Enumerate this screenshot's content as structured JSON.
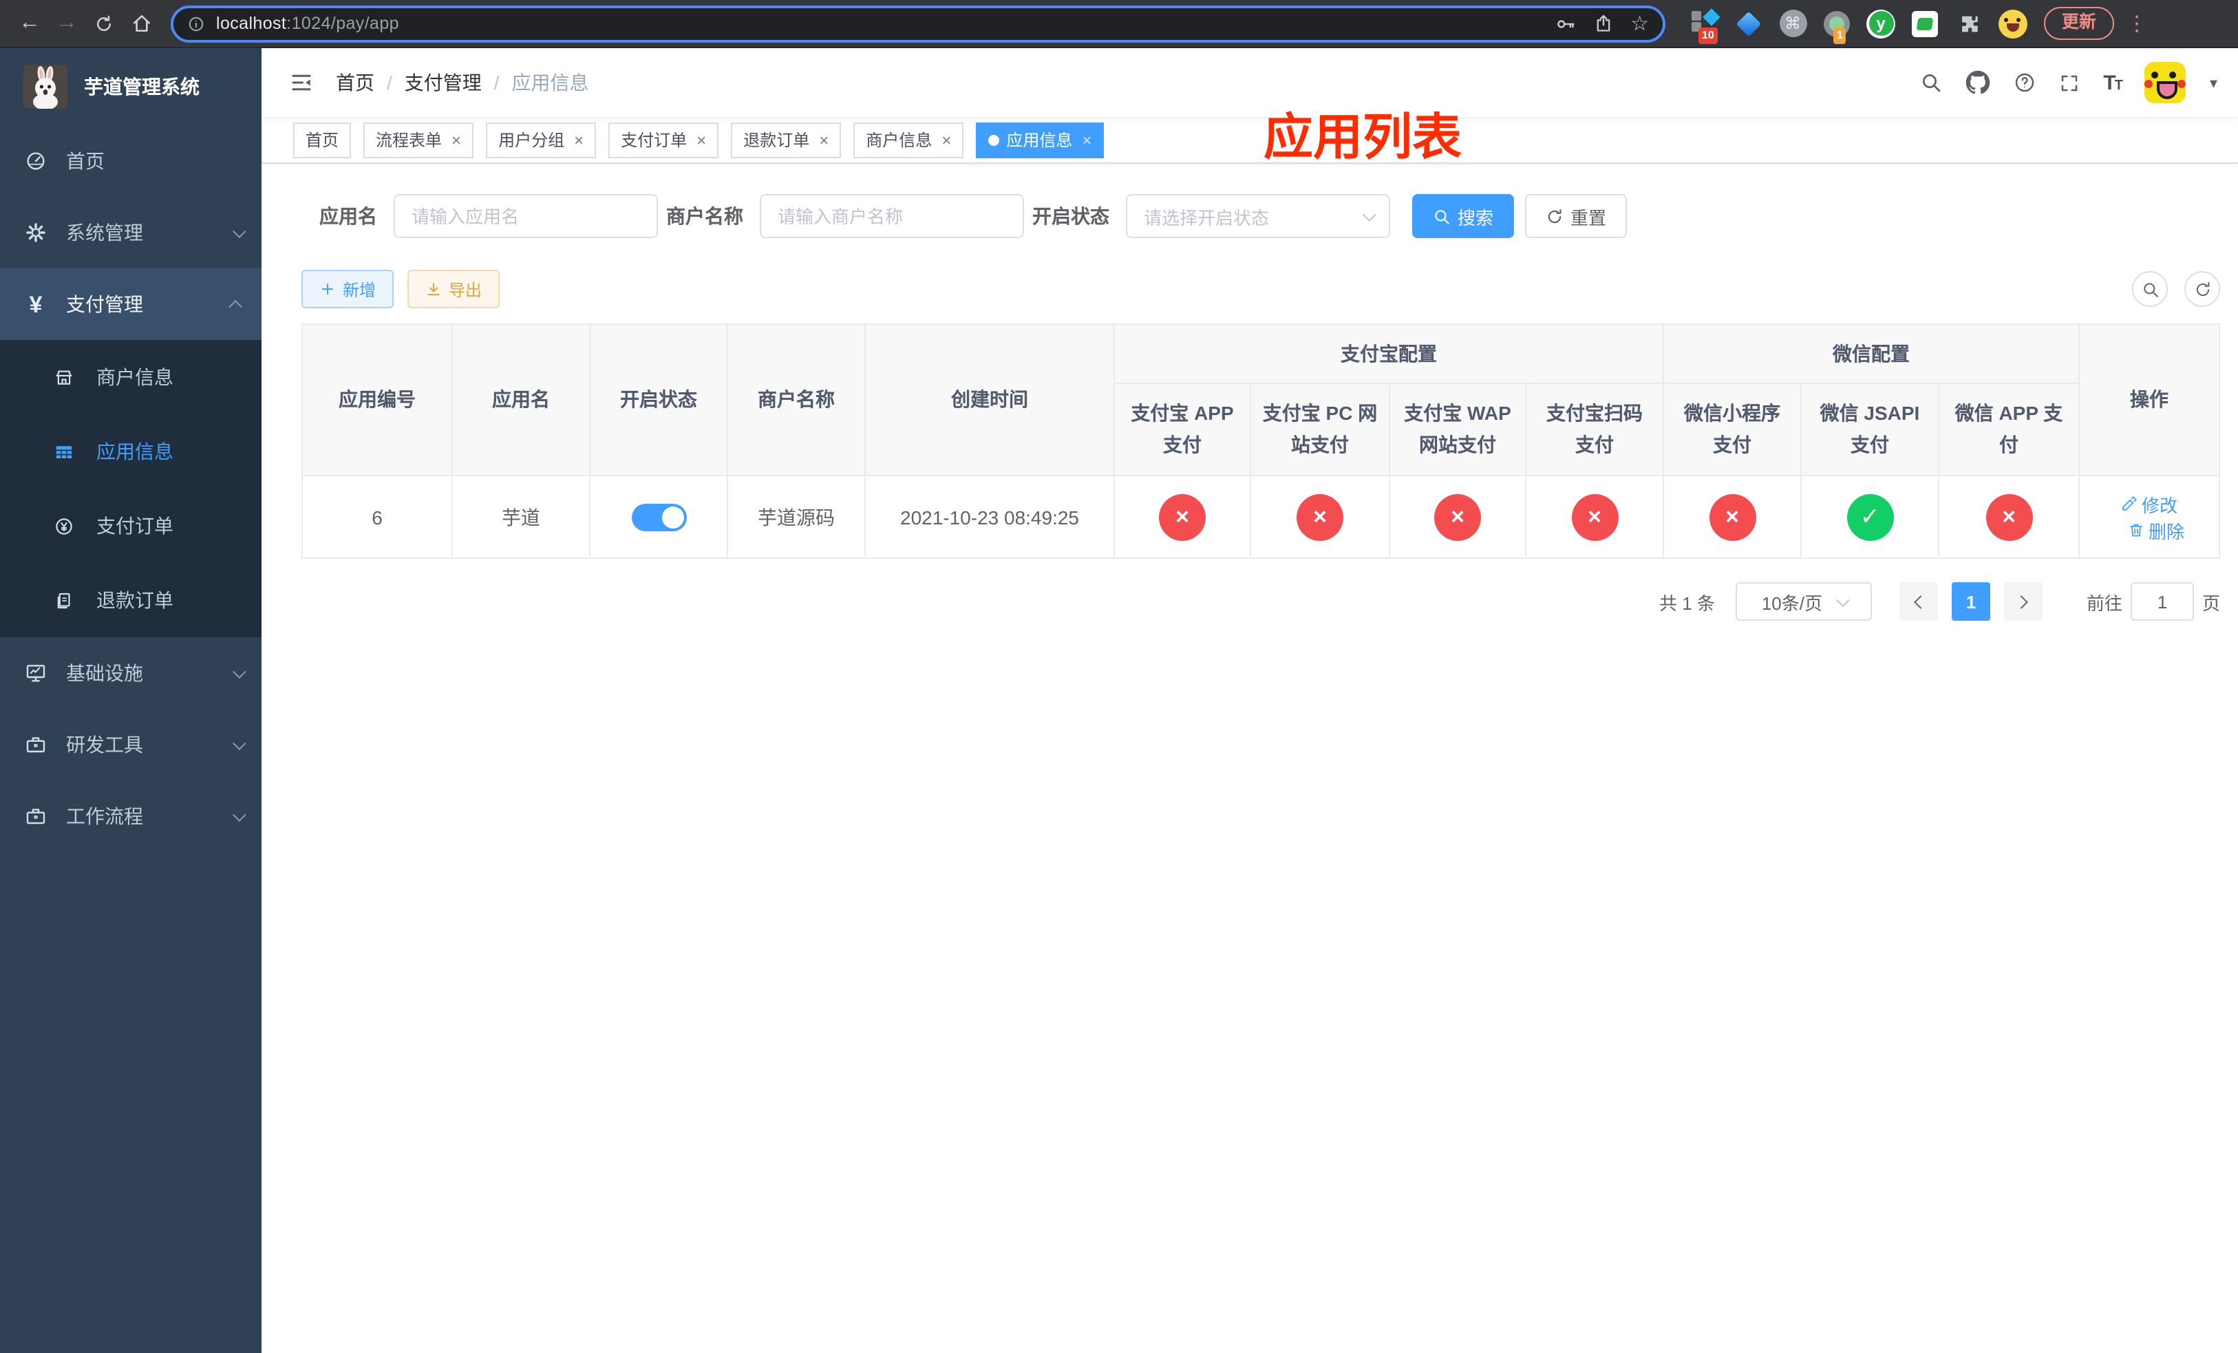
{
  "colors": {
    "accent": "#409eff",
    "success": "#13ce66",
    "danger": "#f34d50",
    "warning": "#e6a23c",
    "sidebar_bg": "#304156",
    "submenu_bg": "#1f2d3d",
    "annotation_red": "#fe2c00"
  },
  "browser": {
    "url_host": "localhost",
    "url_path": ":1024/pay/app",
    "update_label": "更新",
    "extension_badge_1": "10",
    "extension_badge_2": "1",
    "extension_y": "y",
    "extension_command": "⌘"
  },
  "sidebar": {
    "logo_title": "芋道管理系统",
    "items": [
      {
        "label": "首页"
      },
      {
        "label": "系统管理"
      },
      {
        "label": "支付管理"
      },
      {
        "label": "商户信息"
      },
      {
        "label": "应用信息"
      },
      {
        "label": "支付订单"
      },
      {
        "label": "退款订单"
      },
      {
        "label": "基础设施"
      },
      {
        "label": "研发工具"
      },
      {
        "label": "工作流程"
      }
    ]
  },
  "header": {
    "breadcrumb": [
      "首页",
      "支付管理",
      "应用信息"
    ],
    "annotation": "应用列表"
  },
  "tabs": [
    {
      "label": "首页"
    },
    {
      "label": "流程表单"
    },
    {
      "label": "用户分组"
    },
    {
      "label": "支付订单"
    },
    {
      "label": "退款订单"
    },
    {
      "label": "商户信息"
    },
    {
      "label": "应用信息"
    }
  ],
  "filters": {
    "app_name_label": "应用名",
    "app_name_placeholder": "请输入应用名",
    "merchant_label": "商户名称",
    "merchant_placeholder": "请输入商户名称",
    "status_label": "开启状态",
    "status_placeholder": "请选择开启状态",
    "search_label": "搜索",
    "reset_label": "重置"
  },
  "toolbar": {
    "add_label": "新增",
    "export_label": "导出"
  },
  "table": {
    "merged_columns": [
      "应用编号",
      "应用名",
      "开启状态",
      "商户名称",
      "创建时间"
    ],
    "group_alipay": "支付宝配置",
    "group_wechat": "微信配置",
    "alipay_columns": [
      "支付宝 APP 支付",
      "支付宝 PC 网站支付",
      "支付宝 WAP 网站支付",
      "支付宝扫码支付"
    ],
    "wechat_columns": [
      "微信小程序支付",
      "微信 JSAPI 支付",
      "微信 APP 支付"
    ],
    "action_column": "操作",
    "status_true_glyph": "✓",
    "status_false_glyph": "×",
    "row": {
      "id": "6",
      "app_name": "芋道",
      "enabled": true,
      "merchant_name": "芋道源码",
      "create_time": "2021-10-23 08:49:25",
      "statuses": [
        false,
        false,
        false,
        false,
        false,
        true,
        false
      ],
      "edit_label": "修改",
      "delete_label": "删除"
    }
  },
  "pagination": {
    "total_label": "共 1 条",
    "page_size_label": "10条/页",
    "current_page": "1",
    "goto_label": "前往",
    "goto_value": "1",
    "page_unit_label": "页"
  }
}
